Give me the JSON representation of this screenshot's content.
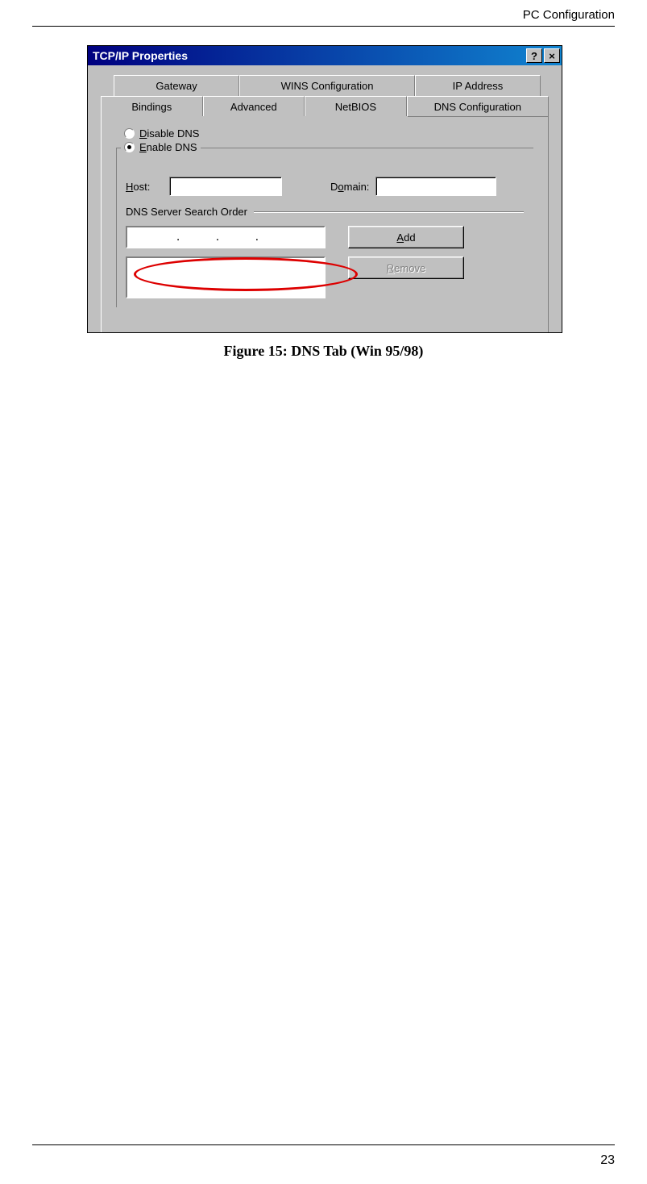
{
  "page": {
    "header": "PC Configuration",
    "number": "23",
    "caption": "Figure 15: DNS Tab (Win 95/98)"
  },
  "dialog": {
    "title": "TCP/IP Properties",
    "help_btn": "?",
    "close_btn": "×",
    "tabs_back": [
      "Gateway",
      "WINS Configuration",
      "IP Address"
    ],
    "tabs_front": [
      "Bindings",
      "Advanced",
      "NetBIOS",
      "DNS Configuration"
    ],
    "active_tab_index": 3,
    "radio_disable_prefix": "D",
    "radio_disable_rest": "isable DNS",
    "radio_enable_prefix": "E",
    "radio_enable_rest": "nable DNS",
    "host_prefix": "H",
    "host_rest": "ost:",
    "domain_prefix": "o",
    "domain_pre": "D",
    "domain_rest": "main:",
    "search_order_label": "DNS Server Search Order",
    "ip_dots": ".     .     .",
    "add_prefix": "A",
    "add_rest": "dd",
    "remove_prefix": "R",
    "remove_rest": "emove"
  }
}
